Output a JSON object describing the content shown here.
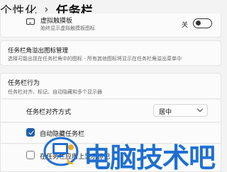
{
  "header": {
    "parent": "个性化",
    "separator": "›",
    "current": "任务栏"
  },
  "touchpad": {
    "title": "虚拟触摸板",
    "description": "始终显示虚拟触摸板图标",
    "toggle_label": "关",
    "toggle_state": "off",
    "icon": "touchpad-icon"
  },
  "overflow": {
    "title": "任务栏角溢出图标管理",
    "description": "选择可能出现在任务栏角中的图标 - 所有其他图标将显示在任务栏角溢出菜单中"
  },
  "behaviors": {
    "title": "任务栏行为",
    "description": "任务栏对齐、标记、自动隐藏和多个显示器"
  },
  "alignment": {
    "label": "任务栏对齐方式",
    "selected": "居中"
  },
  "auto_hide": {
    "label": "自动隐藏任务栏",
    "checked": true
  },
  "badges": {
    "label": "在任务栏应用上显示标记",
    "checked": false
  },
  "watermark": {
    "text": "电脑技术吧",
    "color": "#1f6fd0"
  },
  "colors": {
    "accent": "#1f5fa8",
    "background": "#f3f3f3",
    "card": "#fbfbfb"
  }
}
